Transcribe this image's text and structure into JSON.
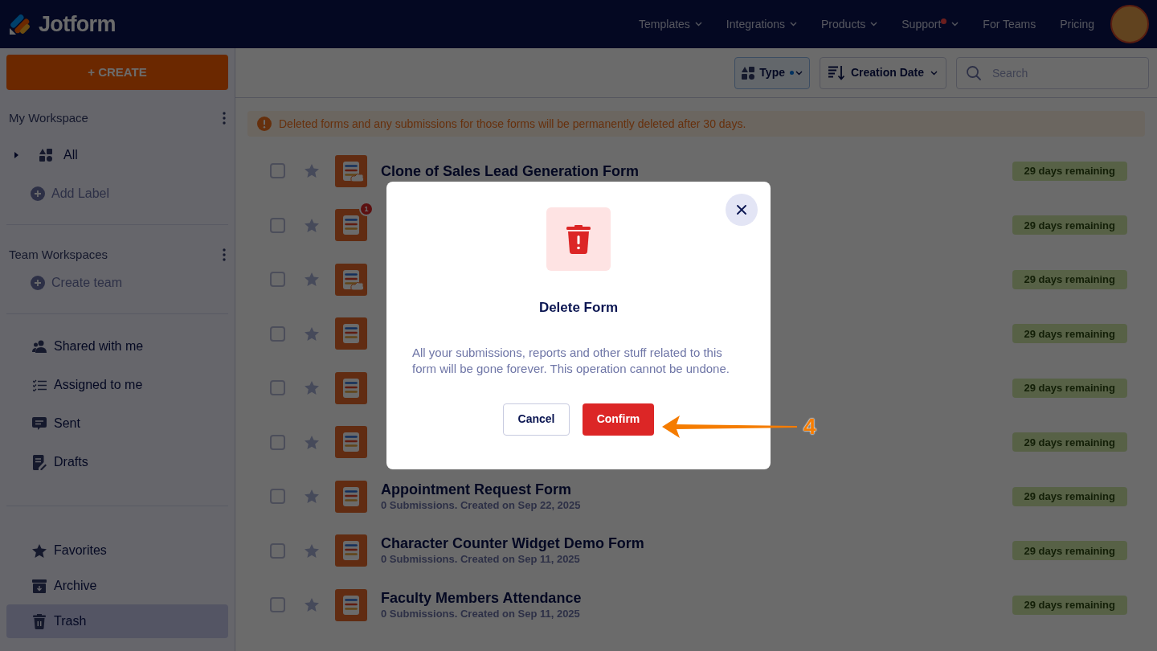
{
  "header": {
    "logo": "Jotform",
    "nav": [
      {
        "label": "Templates",
        "dropdown": true,
        "notification": false
      },
      {
        "label": "Integrations",
        "dropdown": true,
        "notification": false
      },
      {
        "label": "Products",
        "dropdown": true,
        "notification": false
      },
      {
        "label": "Support",
        "dropdown": true,
        "notification": true
      },
      {
        "label": "For Teams",
        "dropdown": false,
        "notification": false
      },
      {
        "label": "Pricing",
        "dropdown": false,
        "notification": false
      }
    ]
  },
  "sidebar": {
    "create_button": "+ CREATE",
    "sections": [
      {
        "title": "My Workspace",
        "items": [
          {
            "label": "All",
            "kind": "folder"
          },
          {
            "label": "Add Label",
            "kind": "add"
          }
        ]
      },
      {
        "title": "Team Workspaces",
        "items": [
          {
            "label": "Create team",
            "kind": "add"
          }
        ]
      }
    ],
    "groups": [
      [
        {
          "label": "Shared with me",
          "kind": "people",
          "selected": false
        },
        {
          "label": "Assigned to me",
          "kind": "checklist",
          "selected": false
        },
        {
          "label": "Sent",
          "kind": "message",
          "selected": false
        },
        {
          "label": "Drafts",
          "kind": "draft",
          "selected": false
        }
      ],
      [
        {
          "label": "Favorites",
          "kind": "star",
          "selected": false
        },
        {
          "label": "Archive",
          "kind": "archive",
          "selected": false
        },
        {
          "label": "Trash",
          "kind": "trash",
          "selected": true
        }
      ]
    ]
  },
  "toolbar": {
    "type_filter": {
      "label": "Type",
      "active": true
    },
    "sort": {
      "label": "Creation Date"
    },
    "search": {
      "placeholder": "Search"
    }
  },
  "notice": "Deleted forms and any submissions for those forms will be permanently deleted after 30 days.",
  "rows": [
    {
      "title": "Clone of Sales Lead Generation Form",
      "checked": false,
      "integration": true,
      "status": "29 days remaining"
    },
    {
      "checked": false,
      "integration": false,
      "badge": "1",
      "status": "29 days remaining"
    },
    {
      "checked": false,
      "integration": true,
      "status": "29 days remaining"
    },
    {
      "checked": false,
      "integration": false,
      "status": "29 days remaining"
    },
    {
      "checked": false,
      "integration": false,
      "status": "29 days remaining"
    },
    {
      "checked": false,
      "integration": false,
      "status": "29 days remaining"
    },
    {
      "title": "Appointment Request Form",
      "subtitle": "0 Submissions. Created on Sep 22, 2025",
      "checked": false,
      "integration": false,
      "status": "29 days remaining"
    },
    {
      "title": "Character Counter Widget Demo Form",
      "subtitle": "0 Submissions. Created on Sep 11, 2025",
      "checked": false,
      "integration": false,
      "status": "29 days remaining"
    },
    {
      "title": "Faculty Members Attendance",
      "subtitle": "0 Submissions. Created on Sep 11, 2025",
      "checked": false,
      "integration": false,
      "status": "29 days remaining"
    }
  ],
  "dialog": {
    "title": "Delete Form",
    "message": "All your submissions, reports and other stuff related to this form will be gone forever. This operation cannot be undone.",
    "buttons": [
      {
        "label": "Cancel",
        "kind": "secondary"
      },
      {
        "label": "Confirm",
        "kind": "danger"
      }
    ]
  },
  "annotation": {
    "label": "4"
  }
}
